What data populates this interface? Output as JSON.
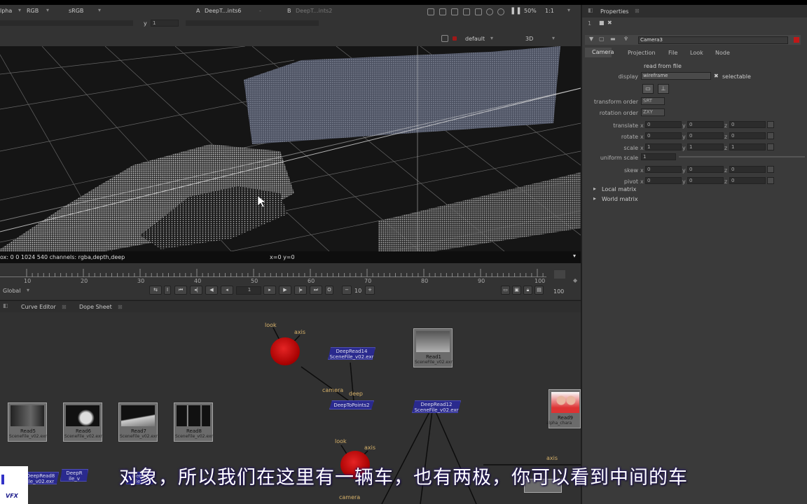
{
  "viewer_toolbar": {
    "channel_alpha": "lpha",
    "channel_rgb": "RGB",
    "colorspace": "sRGB",
    "input_a_label": "A",
    "input_a": "DeepT...ints6",
    "input_b_label": "B",
    "input_b": "DeepT...ints2",
    "zoom": "50%",
    "ratio": "1:1",
    "y_label": "y",
    "y_value": "1",
    "view_mode": "default",
    "view_3d": "3D"
  },
  "info_bar": {
    "format": "ox: 0 0 1024 540 channels: rgba,depth,deep",
    "coords": "x=0 y=0"
  },
  "timeline": {
    "ticks": [
      "10",
      "20",
      "30",
      "40",
      "50",
      "60",
      "70",
      "80",
      "90",
      "100"
    ],
    "scope": "Global",
    "frame": "1",
    "step": "10",
    "end_frame": "100",
    "right_end": "100"
  },
  "panel_tabs": [
    "Curve Editor",
    "Dope Sheet"
  ],
  "node_graph": {
    "read_nodes": [
      {
        "name": "Read5",
        "file": "SceneFile_v02.exr"
      },
      {
        "name": "Read6",
        "file": "SceneFile_v02.exr"
      },
      {
        "name": "Read7",
        "file": "SceneFile_v02.exr"
      },
      {
        "name": "Read8",
        "file": "SceneFile_v02.exr"
      },
      {
        "name": "Read1",
        "file": "SceneFile_v02.exr"
      },
      {
        "name": "Read9",
        "file": "alpha_chara"
      }
    ],
    "deep_nodes": [
      {
        "name": "DeepRead14",
        "file": "SceneFile_v02.exr"
      },
      {
        "name": "DeepToPoints2",
        "file": ""
      },
      {
        "name": "DeepRead12",
        "file": "SceneFile_v02.exr"
      },
      {
        "name": "DeepRead8",
        "file": "ile_v02.exr"
      },
      {
        "name": "DeepR",
        "file": "ile_v"
      },
      {
        "name": "DeepR",
        "file": "ile_v"
      }
    ],
    "labels": {
      "look": "look",
      "axis": "axis",
      "camera": "camera",
      "deep": "deep",
      "look2": "look",
      "axis2": "axis",
      "camera2": "camera",
      "axis3": "axis"
    }
  },
  "properties": {
    "panel_title": "Properties",
    "node_name": "Camera3",
    "tabs": [
      "Camera",
      "Projection",
      "File",
      "Look",
      "Node"
    ],
    "read_from_file": "read from file",
    "display_label": "display",
    "display_value": "wireframe",
    "selectable": "selectable",
    "transform_order_label": "transform order",
    "transform_order": "SRT",
    "rotation_order_label": "rotation order",
    "rotation_order": "ZXY",
    "rows": [
      {
        "label": "translate",
        "x": "0",
        "y": "0",
        "z": "0"
      },
      {
        "label": "rotate",
        "x": "0",
        "y": "0",
        "z": "0"
      },
      {
        "label": "scale",
        "x": "1",
        "y": "1",
        "z": "1"
      },
      {
        "label": "skew",
        "x": "0",
        "y": "0",
        "z": "0"
      },
      {
        "label": "pivot",
        "x": "0",
        "y": "0",
        "z": "0"
      }
    ],
    "uniform_scale_label": "uniform scale",
    "uniform_scale": "1",
    "local_matrix": "Local matrix",
    "world_matrix": "World matrix",
    "x": "x",
    "y": "y",
    "z": "z"
  },
  "subtitle": "对象，所以我们在这里有一辆车，也有两极，你可以看到中间的车",
  "logo_text": "VFX",
  "colors": {
    "accent_red": "#c01818",
    "deep_node": "#2a2a8e",
    "bg": "#313131"
  }
}
